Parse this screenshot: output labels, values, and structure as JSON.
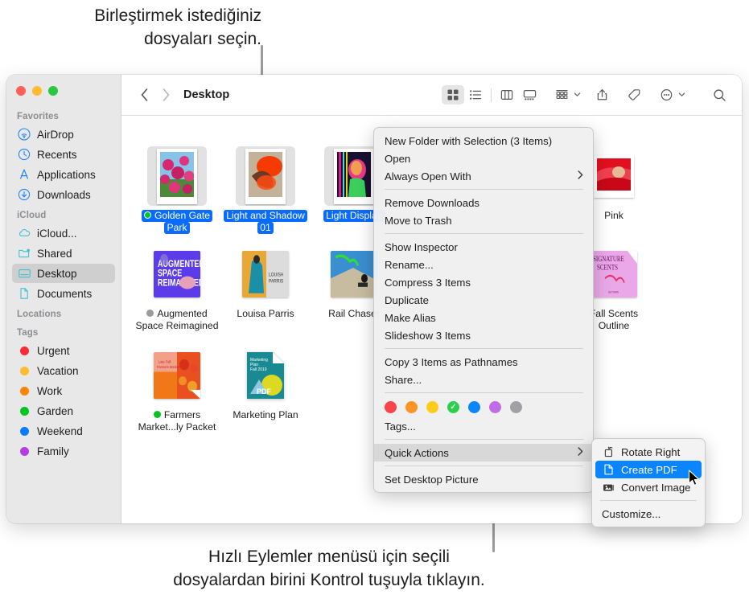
{
  "annotations": {
    "top": "Birleştirmek istediğiniz\ndosyaları seçin.",
    "bottom": "Hızlı Eylemler menüsü için seçili\ndosyalardan birini Kontrol tuşuyla tıklayın."
  },
  "window": {
    "title": "Desktop",
    "traffic_lights": [
      "close",
      "minimize",
      "zoom"
    ]
  },
  "toolbar": {
    "back_label": "‹",
    "forward_label": "›",
    "path": "Desktop",
    "views": [
      {
        "name": "icon-view",
        "active": true
      },
      {
        "name": "list-view",
        "active": false
      },
      {
        "name": "column-view",
        "active": false
      },
      {
        "name": "gallery-view",
        "active": false
      }
    ],
    "group_label": "group-by",
    "share_label": "share",
    "tag_label": "tag",
    "more_label": "more",
    "search_label": "search"
  },
  "sidebar": {
    "sections": [
      {
        "title": "Favorites",
        "items": [
          {
            "label": "AirDrop",
            "icon": "airdrop-icon",
            "color": "#1e86ff",
            "selected": false
          },
          {
            "label": "Recents",
            "icon": "clock-icon",
            "color": "#1e86ff",
            "selected": false
          },
          {
            "label": "Applications",
            "icon": "applications-icon",
            "color": "#1e86ff",
            "selected": false
          },
          {
            "label": "Downloads",
            "icon": "downloads-icon",
            "color": "#1e86ff",
            "selected": false
          }
        ]
      },
      {
        "title": "iCloud",
        "items": [
          {
            "label": "iCloud...",
            "icon": "cloud-icon",
            "color": "#3fc0d4",
            "selected": false
          },
          {
            "label": "Shared",
            "icon": "shared-folder-icon",
            "color": "#3fc0d4",
            "selected": false
          },
          {
            "label": "Desktop",
            "icon": "desktop-icon",
            "color": "#3fc0d4",
            "selected": true
          },
          {
            "label": "Documents",
            "icon": "document-icon",
            "color": "#3fc0d4",
            "selected": false
          }
        ]
      },
      {
        "title": "Locations",
        "items": []
      },
      {
        "title": "Tags",
        "items": [
          {
            "label": "Urgent",
            "icon": "tag-dot-icon",
            "color": "#fb2c36"
          },
          {
            "label": "Vacation",
            "icon": "tag-dot-icon",
            "color": "#fdbc2e"
          },
          {
            "label": "Work",
            "icon": "tag-dot-icon",
            "color": "#fb8500"
          },
          {
            "label": "Garden",
            "icon": "tag-dot-icon",
            "color": "#00c421"
          },
          {
            "label": "Weekend",
            "icon": "tag-dot-icon",
            "color": "#0a7bff"
          },
          {
            "label": "Family",
            "icon": "tag-dot-icon",
            "color": "#b43ce0"
          }
        ]
      }
    ]
  },
  "files": [
    {
      "name_lines": [
        "Golden Gate",
        "Park"
      ],
      "selected": true,
      "tag_color": "#00c421",
      "kind": "photo"
    },
    {
      "name_lines": [
        "Light and Shadow",
        "01"
      ],
      "selected": true,
      "tag_color": null,
      "kind": "photo"
    },
    {
      "name_lines": [
        "Light Display"
      ],
      "selected": true,
      "tag_color": null,
      "kind": "photo"
    },
    {
      "name_lines": [
        "Pink"
      ],
      "selected": false,
      "tag_color": null,
      "kind": "photo"
    },
    {
      "name_lines": [
        "Augmented",
        "Space Reimagined"
      ],
      "selected": false,
      "tag_color": "#9b9b9e",
      "kind": "doc"
    },
    {
      "name_lines": [
        "Louisa Parris"
      ],
      "selected": false,
      "tag_color": null,
      "kind": "doc"
    },
    {
      "name_lines": [
        "Rail Chaser"
      ],
      "selected": false,
      "tag_color": null,
      "kind": "doc"
    },
    {
      "name_lines": [
        "Fall Scents",
        "Outline"
      ],
      "selected": false,
      "tag_color": null,
      "kind": "doc"
    },
    {
      "name_lines": [
        "Farmers",
        "Market...ly Packet"
      ],
      "selected": false,
      "tag_color": "#00c421",
      "kind": "doc"
    },
    {
      "name_lines": [
        "Marketing Plan"
      ],
      "selected": false,
      "tag_color": null,
      "kind": "doc"
    }
  ],
  "context_menu": {
    "items": [
      {
        "label": "New Folder with Selection (3 Items)",
        "submenu": false,
        "highlighted": false
      },
      {
        "label": "Open",
        "submenu": false,
        "highlighted": false
      },
      {
        "label": "Always Open With",
        "submenu": true,
        "highlighted": false
      },
      {
        "separator": true
      },
      {
        "label": "Remove Downloads",
        "submenu": false,
        "highlighted": false
      },
      {
        "label": "Move to Trash",
        "submenu": false,
        "highlighted": false
      },
      {
        "separator": true
      },
      {
        "label": "Show Inspector",
        "submenu": false,
        "highlighted": false
      },
      {
        "label": "Rename...",
        "submenu": false,
        "highlighted": false
      },
      {
        "label": "Compress 3 Items",
        "submenu": false,
        "highlighted": false
      },
      {
        "label": "Duplicate",
        "submenu": false,
        "highlighted": false
      },
      {
        "label": "Make Alias",
        "submenu": false,
        "highlighted": false
      },
      {
        "label": "Slideshow 3 Items",
        "submenu": false,
        "highlighted": false
      },
      {
        "separator": true
      },
      {
        "label": "Copy 3 Items as Pathnames",
        "submenu": false,
        "highlighted": false
      },
      {
        "label": "Share...",
        "submenu": false,
        "highlighted": false
      },
      {
        "separator": true
      },
      {
        "tags_row": true
      },
      {
        "label": "Tags...",
        "submenu": false,
        "highlighted": false
      },
      {
        "separator": true
      },
      {
        "label": "Quick Actions",
        "submenu": true,
        "highlighted": true
      },
      {
        "separator": true
      },
      {
        "label": "Set Desktop Picture",
        "submenu": false,
        "highlighted": false
      }
    ],
    "tag_colors": [
      {
        "name": "red",
        "hex": "#fb4348",
        "checked": false
      },
      {
        "name": "orange",
        "hex": "#fd9426",
        "checked": false
      },
      {
        "name": "yellow",
        "hex": "#fdcb1a",
        "checked": false
      },
      {
        "name": "green",
        "hex": "#2ad04a",
        "checked": true
      },
      {
        "name": "blue",
        "hex": "#0a84ff",
        "checked": false
      },
      {
        "name": "purple",
        "hex": "#c06ce8",
        "checked": false
      },
      {
        "name": "gray",
        "hex": "#a0a0a5",
        "checked": false
      }
    ],
    "arrow_glyph": "›"
  },
  "submenu": {
    "items": [
      {
        "label": "Rotate Right",
        "icon": "rotate-right-icon",
        "highlighted": false,
        "separator_after": false
      },
      {
        "label": "Create PDF",
        "icon": "pdf-page-icon",
        "highlighted": true,
        "separator_after": false
      },
      {
        "label": "Convert Image",
        "icon": "convert-image-icon",
        "highlighted": false,
        "separator_after": true
      },
      {
        "label": "Customize...",
        "icon": null,
        "highlighted": false,
        "separator_after": false
      }
    ]
  }
}
